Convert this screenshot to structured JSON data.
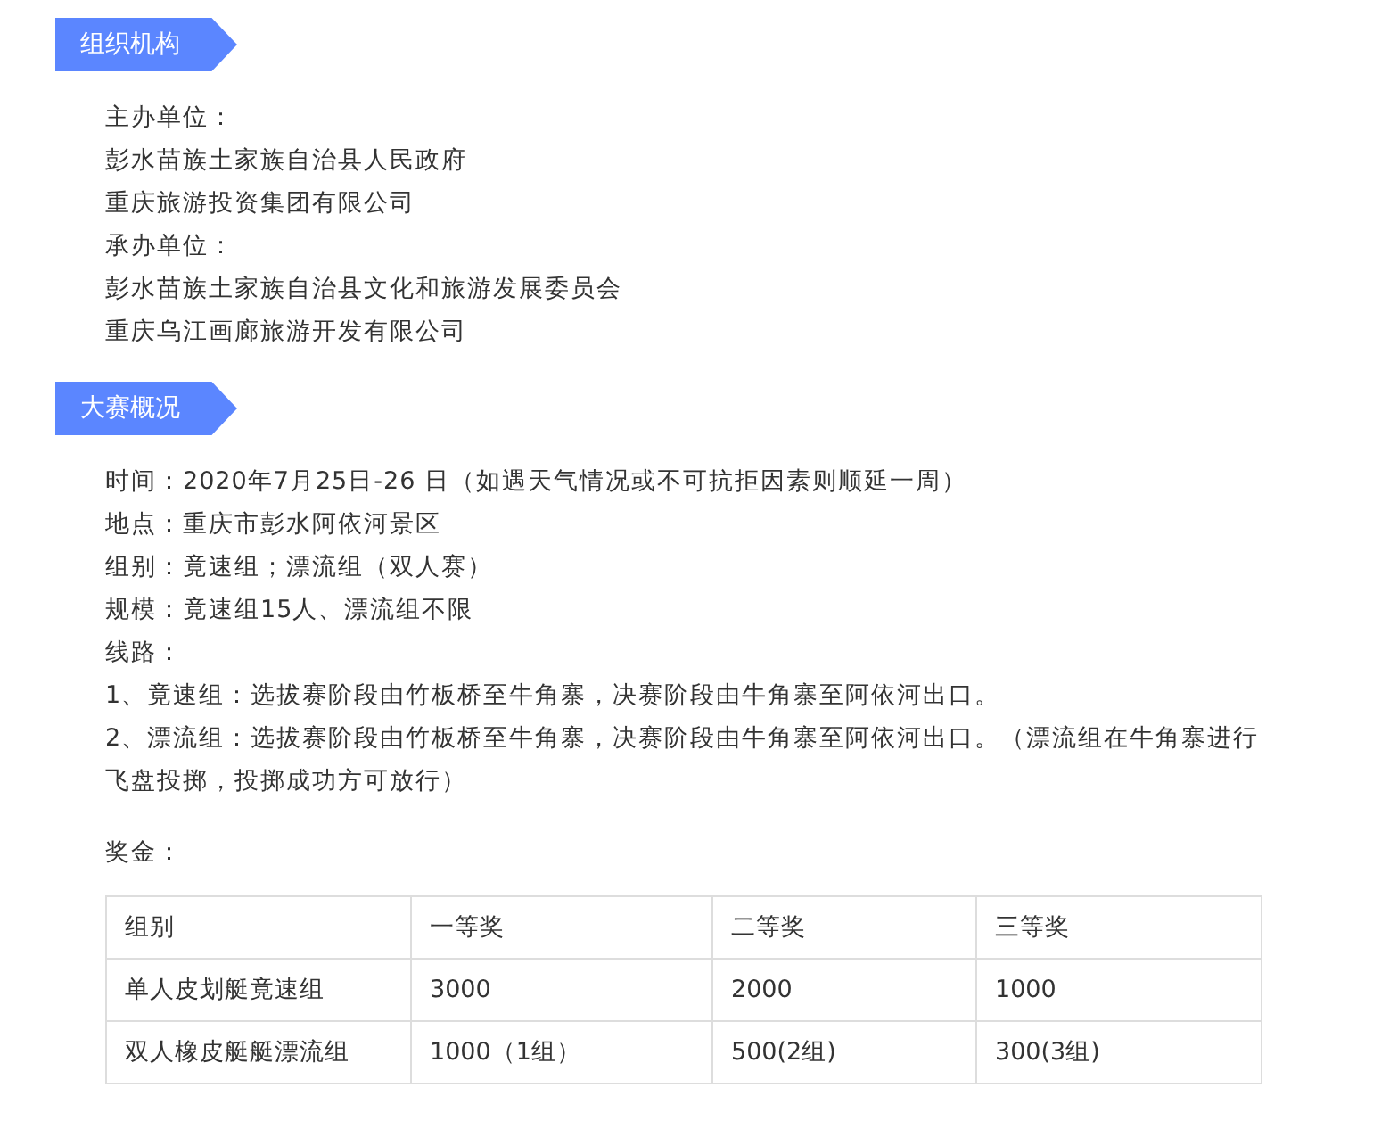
{
  "organizers": {
    "title": "组织机构",
    "lines": [
      "主办单位：",
      "彭水苗族土家族自治县人民政府",
      "重庆旅游投资集团有限公司",
      "承办单位：",
      "彭水苗族土家族自治县文化和旅游发展委员会",
      "重庆乌江画廊旅游开发有限公司"
    ]
  },
  "overview": {
    "title": "大赛概况",
    "lines": [
      "时间：2020年7月25日-26 日（如遇天气情况或不可抗拒因素则顺延一周）",
      "地点：重庆市彭水阿依河景区",
      "组别：竟速组；漂流组（双人赛）",
      "规模：竟速组15人、漂流组不限",
      "线路：",
      "1、竟速组：选拔赛阶段由竹板桥至牛角寨，决赛阶段由牛角寨至阿依河出口。",
      "2、漂流组：选拔赛阶段由竹板桥至牛角寨，决赛阶段由牛角寨至阿依河出口。（漂流组在牛角寨进行飞盘投掷，投掷成功方可放行）"
    ]
  },
  "prize_label": "奖金：",
  "prize_table": {
    "columns": [
      "组别",
      "一等奖",
      "二等奖",
      "三等奖"
    ],
    "rows": [
      [
        "单人皮划艇竟速组",
        "3000",
        "2000",
        "1000"
      ],
      [
        "双人橡皮艇艇漂流组",
        "1000（1组）",
        "500(2组)",
        "300(3组)"
      ]
    ]
  }
}
